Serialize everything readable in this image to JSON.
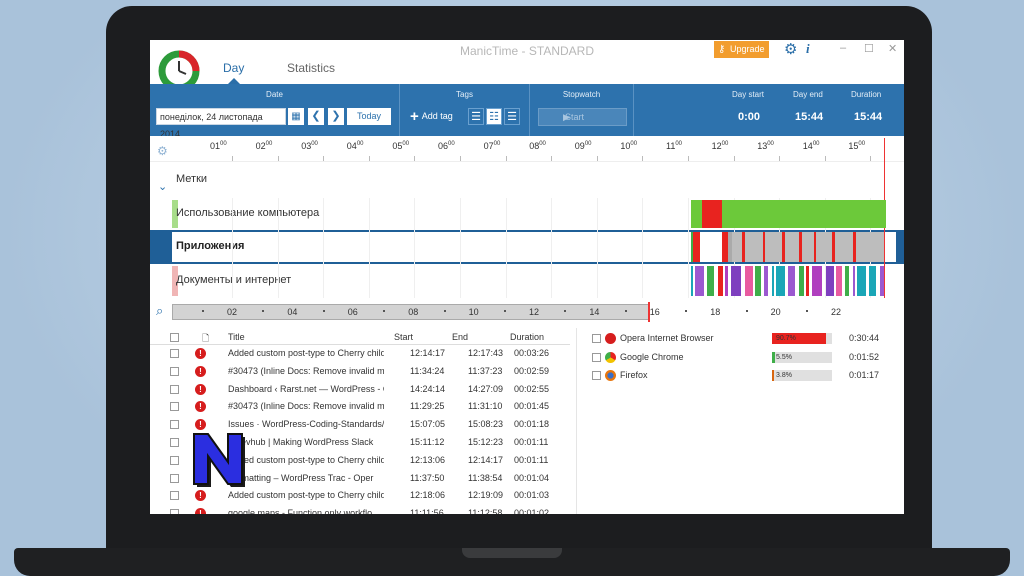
{
  "window": {
    "title": "ManicTime - STANDARD",
    "upgrade_label": "Upgrade",
    "minimize": "–",
    "maximize": "☐",
    "close": "✕"
  },
  "nav": {
    "tabs": [
      {
        "label": "Day"
      },
      {
        "label": "Statistics"
      }
    ]
  },
  "toolbar": {
    "date_group_label": "Date",
    "date_value": "понеділок, 24 листопада 2014",
    "prev_label": "❮",
    "next_label": "❯",
    "today_label": "Today",
    "tags_group_label": "Tags",
    "add_tag_label": "Add tag",
    "stopwatch_group_label": "Stopwatch",
    "start_label": "Start",
    "day_start_label": "Day start",
    "day_start_value": "0:00",
    "day_end_label": "Day end",
    "day_end_value": "15:44",
    "duration_label": "Duration",
    "duration_value": "15:44"
  },
  "timeline": {
    "hours": [
      "01",
      "02",
      "03",
      "04",
      "05",
      "06",
      "07",
      "08",
      "09",
      "10",
      "11",
      "12",
      "13",
      "14",
      "15"
    ],
    "minutes_sup": "00",
    "bands": [
      {
        "label": "Метки"
      },
      {
        "label": "Использование компьютера"
      },
      {
        "label": "Приложения"
      },
      {
        "label": "Документы и интернет"
      }
    ]
  },
  "overview": {
    "labels": [
      "02",
      "04",
      "06",
      "08",
      "10",
      "12",
      "14",
      "16",
      "18",
      "20",
      "22"
    ]
  },
  "activity_table": {
    "columns": {
      "title": "Title",
      "start": "Start",
      "end": "End",
      "duration": "Duration"
    },
    "rows": [
      {
        "title": "Added custom post-type to Cherry child",
        "start": "12:14:17",
        "end": "12:17:43",
        "duration": "00:03:26"
      },
      {
        "title": "#30473 (Inline Docs: Remove invalid ma",
        "start": "11:34:24",
        "end": "11:37:23",
        "duration": "00:02:59"
      },
      {
        "title": "Dashboard ‹ Rarst.net — WordPress - O",
        "start": "14:24:14",
        "end": "14:27:09",
        "duration": "00:02:55"
      },
      {
        "title": "#30473 (Inline Docs: Remove invalid ma",
        "start": "11:29:25",
        "end": "11:31:10",
        "duration": "00:01:45"
      },
      {
        "title": "Issues · WordPress-Coding-Standards/W",
        "start": "15:07:05",
        "end": "15:08:23",
        "duration": "00:01:18"
      },
      {
        "title": "a-devhub | Making WordPress Slack",
        "start": "15:11:12",
        "end": "15:12:23",
        "duration": "00:01:11"
      },
      {
        "title": "Added custom post-type to Cherry child",
        "start": "12:13:06",
        "end": "12:14:17",
        "duration": "00:01:11"
      },
      {
        "title": "Formatting – WordPress Trac - Oper",
        "start": "11:37:50",
        "end": "11:38:54",
        "duration": "00:01:04"
      },
      {
        "title": "Added custom post-type to Cherry child",
        "start": "12:18:06",
        "end": "12:19:09",
        "duration": "00:01:03"
      },
      {
        "title": "google maps - Function only workflo",
        "start": "11:11:56",
        "end": "11:12:58",
        "duration": "00:01:02"
      }
    ]
  },
  "apps": [
    {
      "name": "Opera Internet Browser",
      "percent_label": "90.7%",
      "percent": 90.7,
      "duration": "0:30:44",
      "color": "#e8231f"
    },
    {
      "name": "Google Chrome",
      "percent_label": "5.5%",
      "percent": 5.5,
      "duration": "0:01:52",
      "color": "#3fae49"
    },
    {
      "name": "Firefox",
      "percent_label": "3.8%",
      "percent": 3.8,
      "duration": "0:01:17",
      "color": "#d9660f"
    }
  ],
  "colors": {
    "accent": "#2d72ad",
    "active_green": "#6cc93a",
    "opera_red": "#e8231f"
  }
}
